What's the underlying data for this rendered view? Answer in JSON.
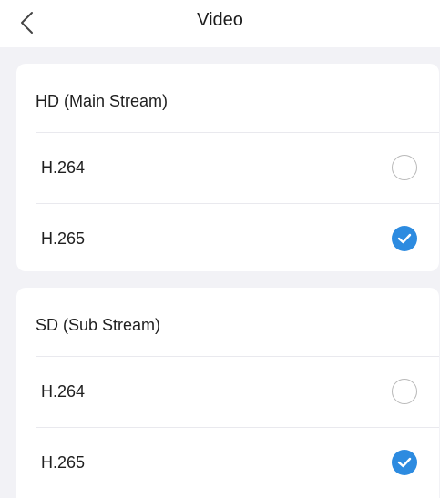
{
  "header": {
    "title": "Video",
    "back_icon": "chevron-left-icon"
  },
  "sections": [
    {
      "title": "HD (Main Stream)",
      "options": [
        {
          "label": "H.264",
          "selected": false
        },
        {
          "label": "H.265",
          "selected": true
        }
      ]
    },
    {
      "title": "SD (Sub Stream)",
      "options": [
        {
          "label": "H.264",
          "selected": false
        },
        {
          "label": "H.265",
          "selected": true
        }
      ]
    }
  ],
  "colors": {
    "accent": "#2d8be0",
    "background": "#f2f2f6",
    "card": "#ffffff",
    "divider": "#e9e9ee"
  }
}
